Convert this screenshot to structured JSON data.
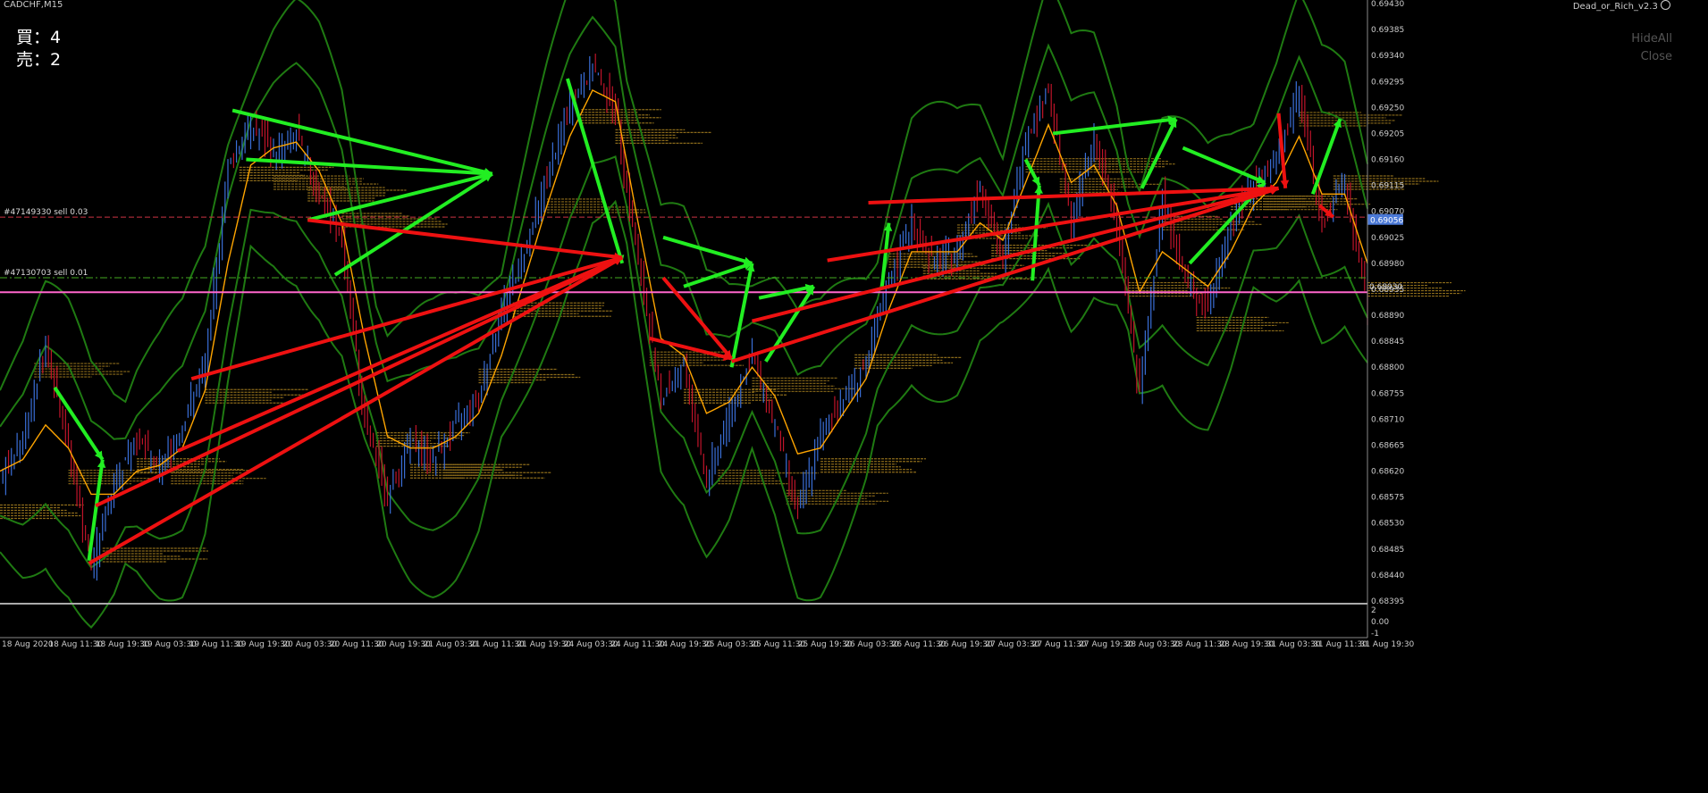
{
  "symbol_label": "CADCHF,M15",
  "indicator_label": "Dead_or_Rich_v2.3",
  "indicator_icon": "smiley-icon",
  "buy_text": "買：4",
  "sell_text": "売：2",
  "hideall_label": "HideAll",
  "close_label": "Close",
  "colors": {
    "background": "#000000",
    "bull_candle": "#3a6fd8",
    "bear_candle": "#c0142a",
    "ma_line": "#ffa500",
    "band_line": "#1f7a12",
    "buy_arrow": "#22ee22",
    "sell_arrow": "#ee1111",
    "current_price_box": "#4a78d6",
    "level_pink": "#ff66cc",
    "depth_blocks": "#8a6a1a"
  },
  "chart_data": {
    "type": "candlestick",
    "timeframe": "M15",
    "ylim": [
      0.68395,
      0.6943
    ],
    "price_ticks": [
      "0.69430",
      "0.69385",
      "0.69340",
      "0.69295",
      "0.69250",
      "0.69205",
      "0.69160",
      "0.69115",
      "0.69070",
      "0.69025",
      "0.68980",
      "0.68935",
      "0.68890",
      "0.68845",
      "0.68800",
      "0.68755",
      "0.68710",
      "0.68665",
      "0.68620",
      "0.68575",
      "0.68530",
      "0.68485",
      "0.68440",
      "0.68395"
    ],
    "x_tick_labels": [
      "18 Aug 2020",
      "18 Aug 11:30",
      "18 Aug 19:30",
      "19 Aug 03:30",
      "19 Aug 11:30",
      "19 Aug 19:30",
      "20 Aug 03:30",
      "20 Aug 11:30",
      "20 Aug 19:30",
      "21 Aug 03:30",
      "21 Aug 11:30",
      "21 Aug 19:30",
      "24 Aug 03:30",
      "24 Aug 11:30",
      "24 Aug 19:30",
      "25 Aug 03:30",
      "25 Aug 11:30",
      "25 Aug 19:30",
      "26 Aug 03:30",
      "26 Aug 11:30",
      "26 Aug 19:30",
      "27 Aug 03:30",
      "27 Aug 11:30",
      "27 Aug 19:30",
      "28 Aug 03:30",
      "28 Aug 11:30",
      "28 Aug 19:30",
      "31 Aug 03:30",
      "31 Aug 11:30",
      "31 Aug 19:30"
    ],
    "price_path": [
      0.686,
      0.6868,
      0.6884,
      0.6866,
      0.6845,
      0.686,
      0.6868,
      0.6862,
      0.687,
      0.688,
      0.6915,
      0.6922,
      0.6917,
      0.692,
      0.691,
      0.6902,
      0.687,
      0.6858,
      0.6867,
      0.6864,
      0.687,
      0.6875,
      0.689,
      0.69,
      0.6913,
      0.6925,
      0.6932,
      0.6925,
      0.6898,
      0.6875,
      0.688,
      0.686,
      0.6872,
      0.6882,
      0.687,
      0.6855,
      0.6868,
      0.6875,
      0.688,
      0.6895,
      0.6905,
      0.6898,
      0.69,
      0.6912,
      0.6898,
      0.692,
      0.6928,
      0.6905,
      0.692,
      0.6905,
      0.6875,
      0.691,
      0.6895,
      0.689,
      0.6905,
      0.6912,
      0.6915,
      0.6928,
      0.6905,
      0.6912,
      0.689
    ],
    "ma_path": [
      0.6862,
      0.6864,
      0.687,
      0.6866,
      0.6858,
      0.6858,
      0.6862,
      0.6863,
      0.6866,
      0.6876,
      0.6898,
      0.6915,
      0.6918,
      0.6919,
      0.6914,
      0.6905,
      0.6885,
      0.6868,
      0.6866,
      0.6866,
      0.6868,
      0.6872,
      0.6882,
      0.6895,
      0.6908,
      0.692,
      0.6928,
      0.6926,
      0.6905,
      0.6885,
      0.6882,
      0.6872,
      0.6874,
      0.688,
      0.6875,
      0.6865,
      0.6866,
      0.6872,
      0.6878,
      0.689,
      0.69,
      0.69,
      0.69,
      0.6905,
      0.6902,
      0.6912,
      0.6922,
      0.6912,
      0.6915,
      0.6908,
      0.6893,
      0.69,
      0.6897,
      0.6894,
      0.69,
      0.6908,
      0.6912,
      0.692,
      0.691,
      0.691,
      0.6898
    ],
    "band_width": 0.002,
    "current_price": "0.69056",
    "current_price_value": 0.69056,
    "horizontal_levels": [
      {
        "label": "#47149330 sell 0.03",
        "price": 0.6906,
        "style": "dashed",
        "color": "#cc3344"
      },
      {
        "label": "#47130703 sell 0.01",
        "price": 0.68955,
        "style": "dashdot",
        "color": "#44aa22"
      },
      {
        "label": "0.68930",
        "price": 0.6893,
        "style": "solid",
        "color": "#ff66cc"
      }
    ],
    "trade_arrows": [
      {
        "side": "buy",
        "from": [
          0.08,
          0.68765
        ],
        "to": [
          0.15,
          0.6864
        ]
      },
      {
        "side": "buy",
        "from": [
          0.13,
          0.68465
        ],
        "to": [
          0.15,
          0.6864
        ]
      },
      {
        "side": "buy",
        "from": [
          0.34,
          0.69245
        ],
        "to": [
          0.72,
          0.69135
        ]
      },
      {
        "side": "buy",
        "from": [
          0.36,
          0.6916
        ],
        "to": [
          0.72,
          0.69135
        ]
      },
      {
        "side": "buy",
        "from": [
          0.45,
          0.69055
        ],
        "to": [
          0.72,
          0.69135
        ]
      },
      {
        "side": "buy",
        "from": [
          0.49,
          0.6896
        ],
        "to": [
          0.72,
          0.69135
        ]
      },
      {
        "side": "buy",
        "from": [
          0.83,
          0.693
        ],
        "to": [
          0.91,
          0.6898
        ]
      },
      {
        "side": "buy",
        "from": [
          0.97,
          0.69025
        ],
        "to": [
          1.1,
          0.6898
        ]
      },
      {
        "side": "buy",
        "from": [
          1.0,
          0.6894
        ],
        "to": [
          1.1,
          0.6898
        ]
      },
      {
        "side": "buy",
        "from": [
          1.07,
          0.688
        ],
        "to": [
          1.1,
          0.6898
        ]
      },
      {
        "side": "buy",
        "from": [
          1.11,
          0.6892
        ],
        "to": [
          1.19,
          0.6894
        ]
      },
      {
        "side": "buy",
        "from": [
          1.12,
          0.6881
        ],
        "to": [
          1.19,
          0.6894
        ]
      },
      {
        "side": "buy",
        "from": [
          1.29,
          0.6894
        ],
        "to": [
          1.3,
          0.6905
        ]
      },
      {
        "side": "buy",
        "from": [
          1.51,
          0.6895
        ],
        "to": [
          1.52,
          0.69115
        ]
      },
      {
        "side": "buy",
        "from": [
          1.5,
          0.6916
        ],
        "to": [
          1.52,
          0.69115
        ]
      },
      {
        "side": "buy",
        "from": [
          1.54,
          0.69205
        ],
        "to": [
          1.72,
          0.6923
        ]
      },
      {
        "side": "buy",
        "from": [
          1.67,
          0.6911
        ],
        "to": [
          1.72,
          0.6923
        ]
      },
      {
        "side": "buy",
        "from": [
          1.73,
          0.6918
        ],
        "to": [
          1.85,
          0.6912
        ]
      },
      {
        "side": "buy",
        "from": [
          1.74,
          0.6898
        ],
        "to": [
          1.85,
          0.6912
        ]
      },
      {
        "side": "buy",
        "from": [
          1.92,
          0.691
        ],
        "to": [
          1.96,
          0.6923
        ]
      },
      {
        "side": "sell",
        "from": [
          0.45,
          0.69055
        ],
        "to": [
          0.91,
          0.6899
        ]
      },
      {
        "side": "sell",
        "from": [
          0.28,
          0.6878
        ],
        "to": [
          0.91,
          0.6899
        ]
      },
      {
        "side": "sell",
        "from": [
          0.26,
          0.68655
        ],
        "to": [
          0.91,
          0.6899
        ]
      },
      {
        "side": "sell",
        "from": [
          0.14,
          0.6856
        ],
        "to": [
          0.91,
          0.6899
        ]
      },
      {
        "side": "sell",
        "from": [
          0.13,
          0.6846
        ],
        "to": [
          0.91,
          0.6899
        ]
      },
      {
        "side": "sell",
        "from": [
          0.97,
          0.68955
        ],
        "to": [
          1.07,
          0.68815
        ]
      },
      {
        "side": "sell",
        "from": [
          0.95,
          0.6885
        ],
        "to": [
          1.07,
          0.68815
        ]
      },
      {
        "side": "sell",
        "from": [
          1.07,
          0.6881
        ],
        "to": [
          1.87,
          0.6911
        ]
      },
      {
        "side": "sell",
        "from": [
          1.1,
          0.6888
        ],
        "to": [
          1.87,
          0.6911
        ]
      },
      {
        "side": "sell",
        "from": [
          1.21,
          0.68985
        ],
        "to": [
          1.87,
          0.6911
        ]
      },
      {
        "side": "sell",
        "from": [
          1.27,
          0.69085
        ],
        "to": [
          1.87,
          0.6911
        ]
      },
      {
        "side": "sell",
        "from": [
          1.87,
          0.6924
        ],
        "to": [
          1.88,
          0.6911
        ]
      },
      {
        "side": "sell",
        "from": [
          1.93,
          0.6908
        ],
        "to": [
          1.95,
          0.6906
        ]
      }
    ],
    "subwindow": {
      "ticks": [
        "2",
        "0.00",
        "-1"
      ]
    }
  }
}
